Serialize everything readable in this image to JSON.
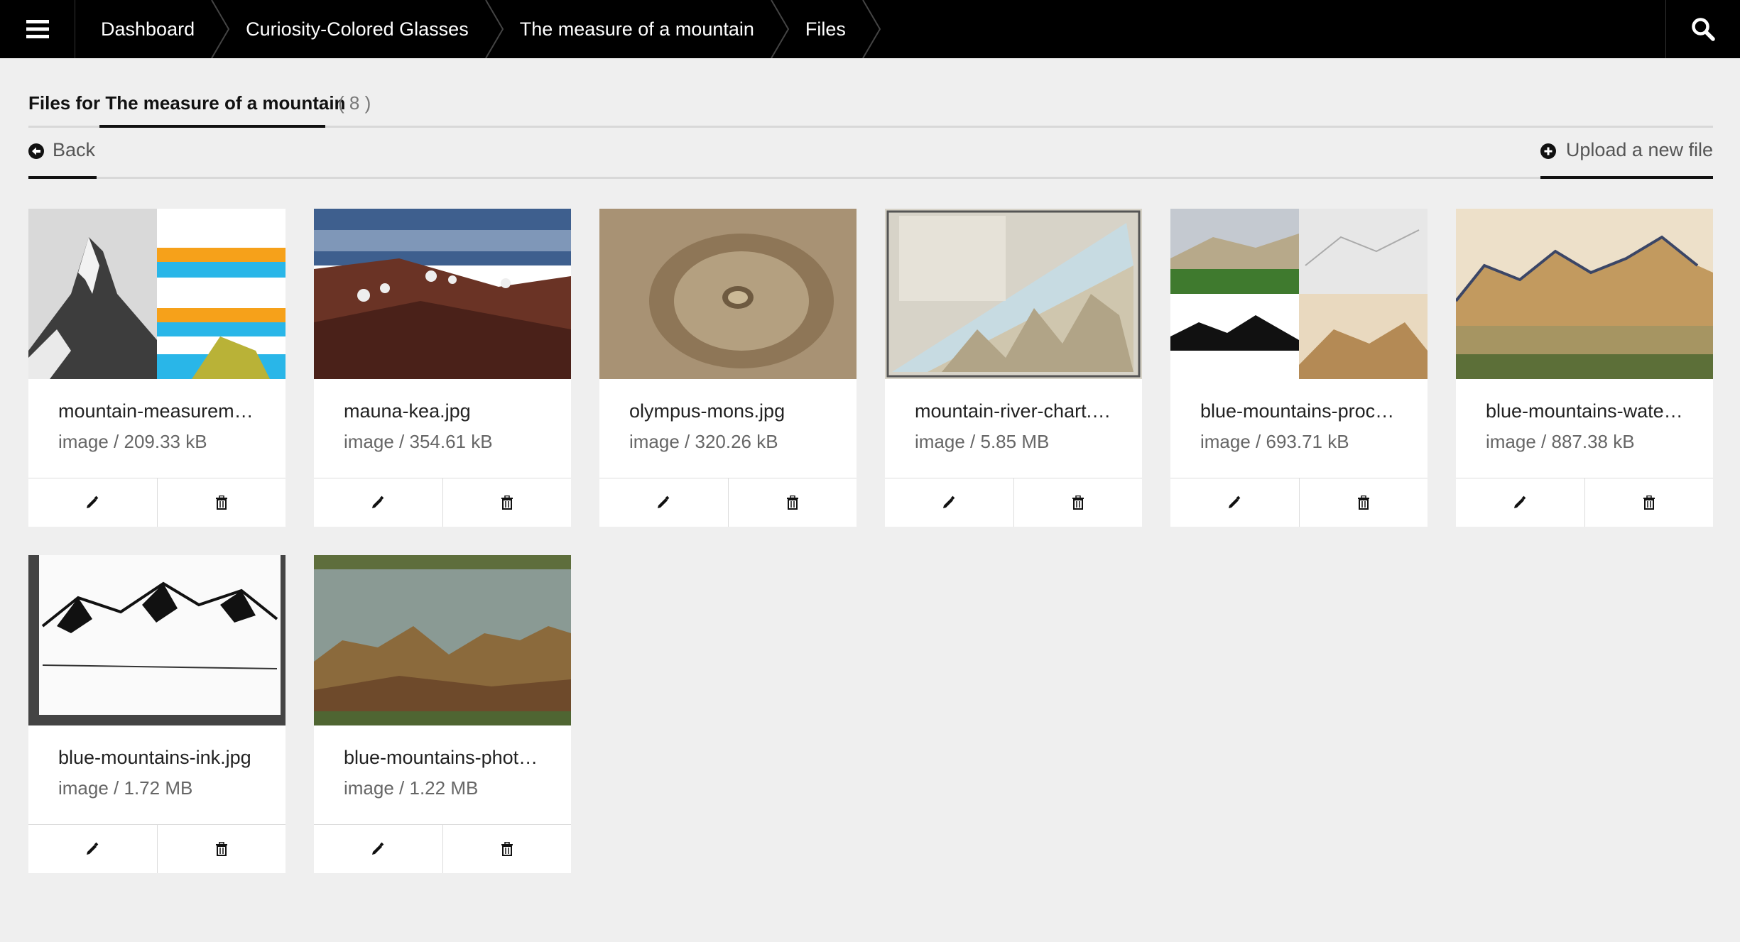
{
  "nav": {
    "breadcrumbs": [
      "Dashboard",
      "Curiosity-Colored Glasses",
      "The measure of a mountain",
      "Files"
    ]
  },
  "tab": {
    "title": "Files for The measure of a mountain",
    "count": "( 8 )"
  },
  "actions": {
    "back_label": "Back",
    "upload_label": "Upload a new file"
  },
  "files": [
    {
      "name": "mountain-measurem…",
      "meta": "image / 209.33 kB"
    },
    {
      "name": "mauna-kea.jpg",
      "meta": "image / 354.61 kB"
    },
    {
      "name": "olympus-mons.jpg",
      "meta": "image / 320.26 kB"
    },
    {
      "name": "mountain-river-chart.…",
      "meta": "image / 5.85 MB"
    },
    {
      "name": "blue-mountains-proc…",
      "meta": "image / 693.71 kB"
    },
    {
      "name": "blue-mountains-wate…",
      "meta": "image / 887.38 kB"
    },
    {
      "name": "blue-mountains-ink.jpg",
      "meta": "image / 1.72 MB"
    },
    {
      "name": "blue-mountains-phot…",
      "meta": "image / 1.22 MB"
    }
  ],
  "icons": {
    "menu": "hamburger-icon",
    "search": "search-icon",
    "back": "arrow-left-circle-icon",
    "upload": "plus-circle-icon",
    "edit": "pencil-icon",
    "delete": "trash-icon"
  }
}
